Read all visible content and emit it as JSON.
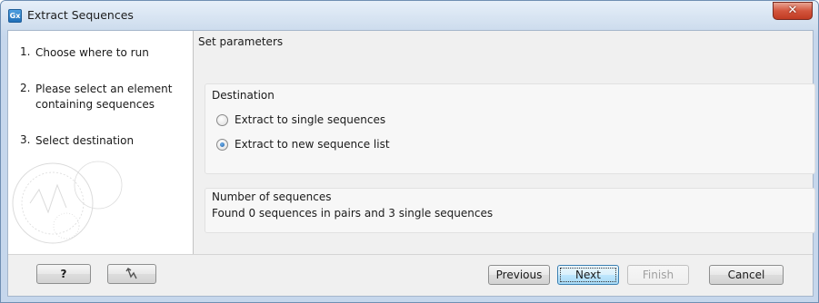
{
  "window": {
    "title": "Extract Sequences",
    "app_icon_text": "Gx",
    "close_glyph": "✕"
  },
  "steps": [
    {
      "num": "1.",
      "label": "Choose where to run"
    },
    {
      "num": "2.",
      "label": "Please select an element containing sequences"
    },
    {
      "num": "3.",
      "label": "Select destination"
    }
  ],
  "content": {
    "header": "Set parameters",
    "destination": {
      "title": "Destination",
      "options": [
        {
          "label": "Extract to single sequences",
          "selected": false
        },
        {
          "label": "Extract to new sequence list",
          "selected": true
        }
      ]
    },
    "number_of_sequences": {
      "title": "Number of sequences",
      "text": "Found 0 sequences in pairs and 3 single sequences"
    }
  },
  "footer": {
    "help_label": "?",
    "reset_icon": "reset-arrow-icon",
    "previous_label": "Previous",
    "next_label": "Next",
    "finish_label": "Finish",
    "cancel_label": "Cancel"
  }
}
